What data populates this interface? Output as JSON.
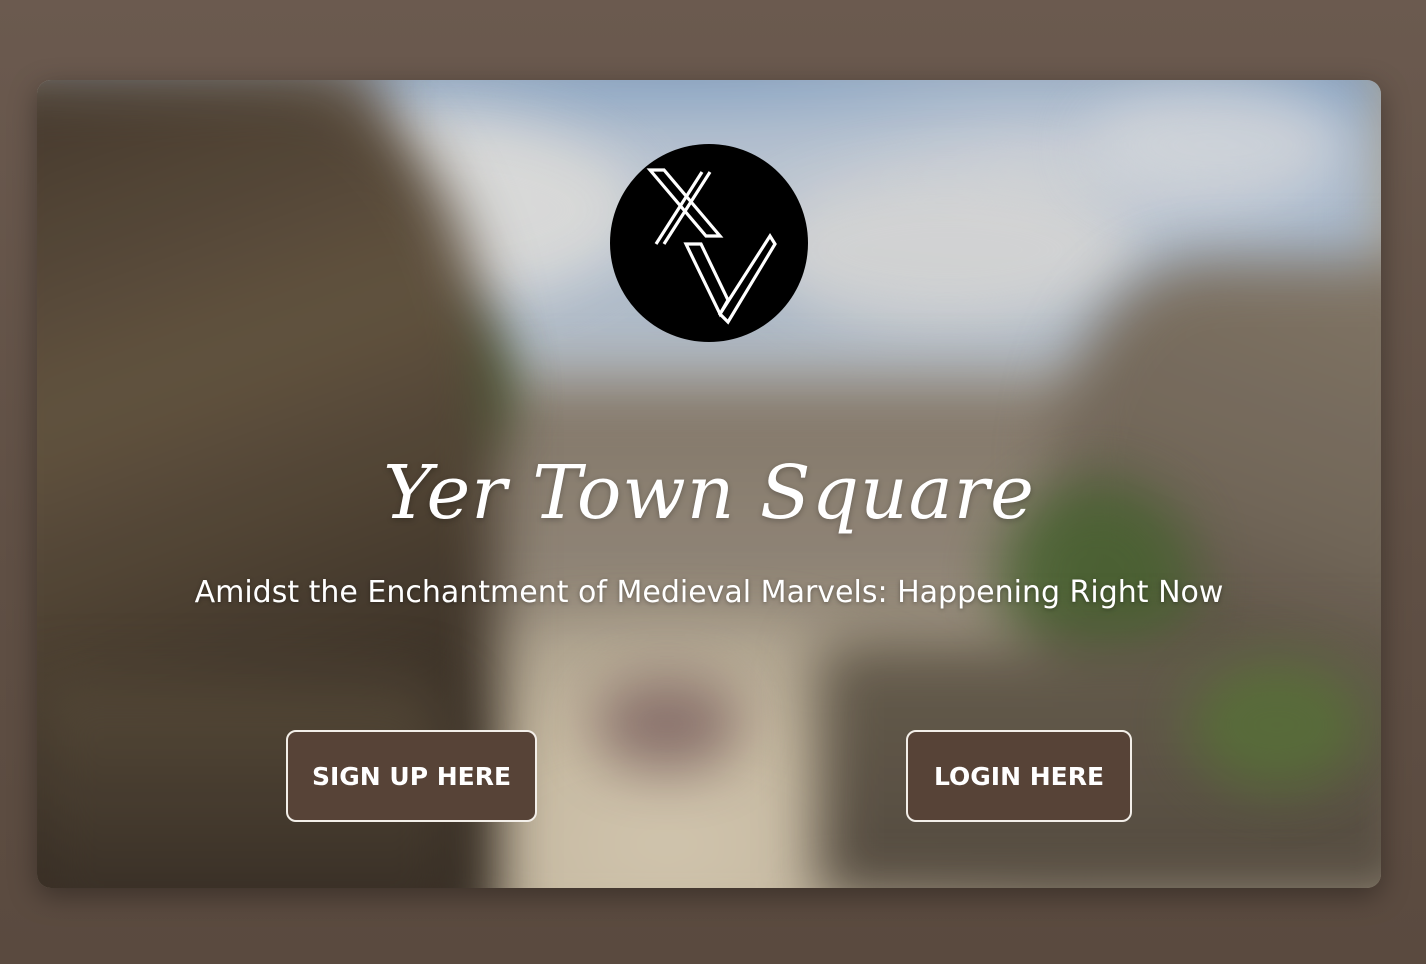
{
  "hero": {
    "logo_text": "XV",
    "title": "Yer Town Square",
    "tagline": "Amidst the Enchantment of Medieval Marvels: Happening Right Now"
  },
  "actions": {
    "signup_label": "SIGN UP HERE",
    "login_label": "LOGIN HERE"
  },
  "colors": {
    "page_background": "#5e4e43",
    "button_background": "#574337",
    "button_border": "#f3efe9",
    "logo_background": "#000000",
    "text": "#ffffff"
  },
  "background_image": "blurred medieval village street with thatched houses"
}
